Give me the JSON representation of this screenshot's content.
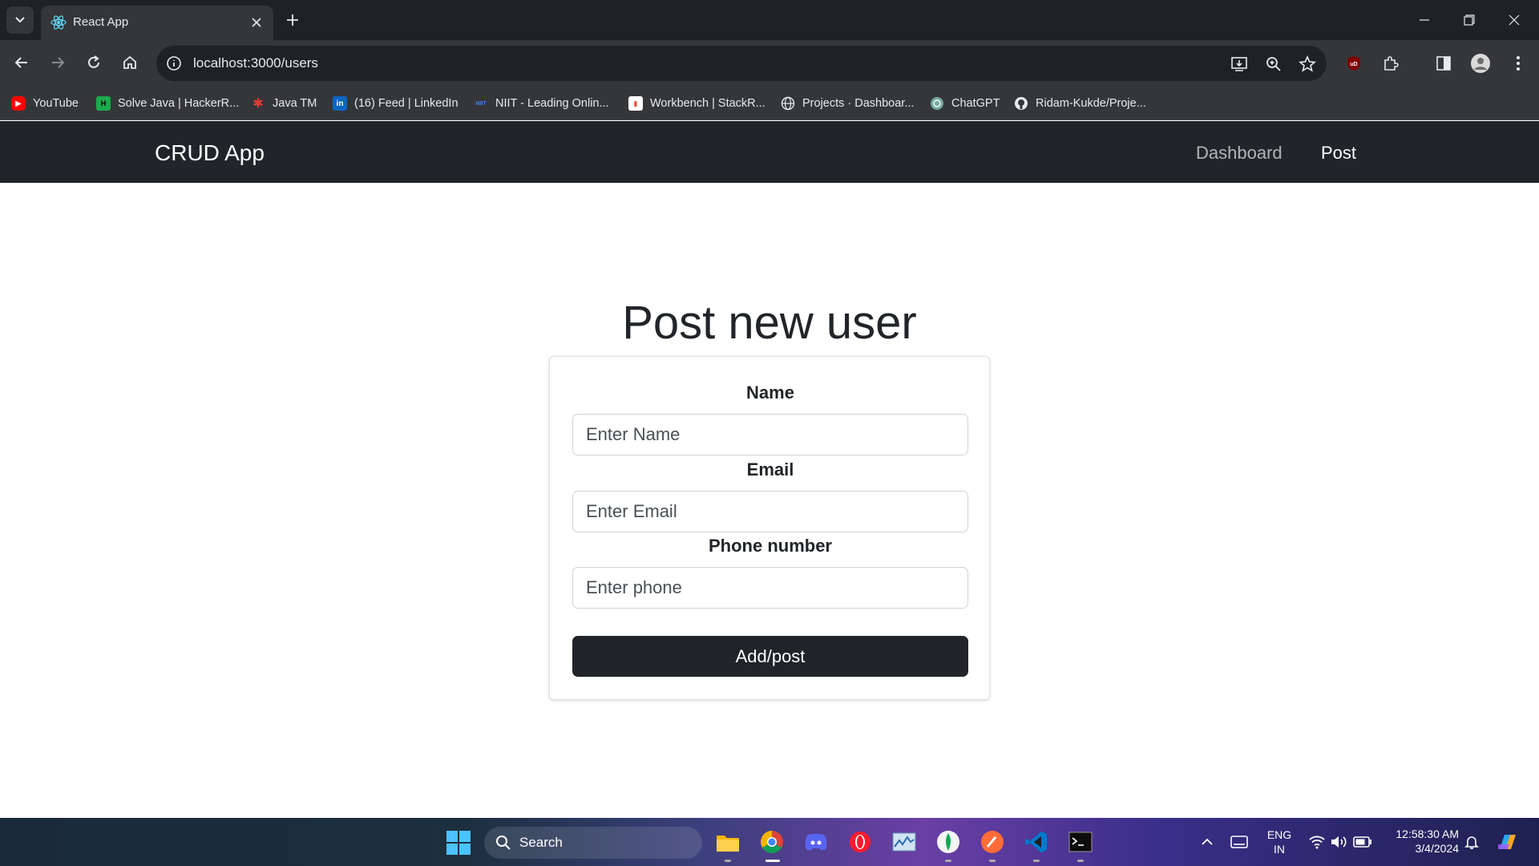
{
  "browser": {
    "tab_title": "React App",
    "url": "localhost:3000/users",
    "bookmarks": [
      {
        "label": "YouTube",
        "icon": "youtube-icon"
      },
      {
        "label": "Solve Java | HackerR...",
        "icon": "hackerrank-icon"
      },
      {
        "label": "Java TM",
        "icon": "java-icon"
      },
      {
        "label": "(16) Feed | LinkedIn",
        "icon": "linkedin-icon"
      },
      {
        "label": "NIIT - Leading Onlin...",
        "icon": "niit-icon"
      },
      {
        "label": "Workbench | StackR...",
        "icon": "stackroute-icon"
      },
      {
        "label": "Projects · Dashboar...",
        "icon": "globe-icon"
      },
      {
        "label": "ChatGPT",
        "icon": "chatgpt-icon"
      },
      {
        "label": "Ridam-Kukde/Proje...",
        "icon": "github-icon"
      }
    ]
  },
  "app": {
    "brand": "CRUD App",
    "nav": {
      "dashboard": "Dashboard",
      "post": "Post"
    },
    "page_title": "Post new user",
    "form": {
      "name_label": "Name",
      "name_placeholder": "Enter Name",
      "email_label": "Email",
      "email_placeholder": "Enter Email",
      "phone_label": "Phone number",
      "phone_placeholder": "Enter phone",
      "submit_label": "Add/post"
    }
  },
  "taskbar": {
    "search_label": "Search",
    "language": "ENG",
    "region": "IN",
    "time": "12:58:30 AM",
    "date": "3/4/2024"
  },
  "colors": {
    "navbar_bg": "#212529",
    "button_bg": "#212529",
    "chrome_dark": "#202124",
    "chrome_toolbar": "#35363a"
  }
}
